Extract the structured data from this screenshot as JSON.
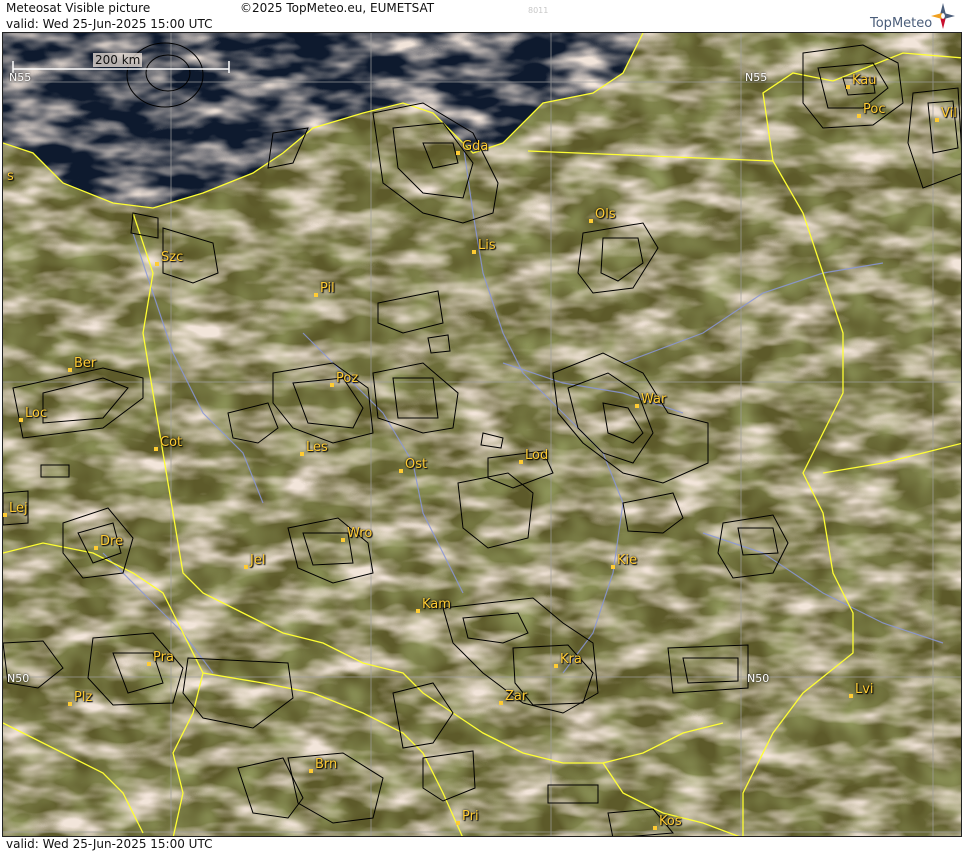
{
  "header": {
    "title": "Meteosat Visible picture",
    "valid": "valid:  Wed  25-Jun-2025  15:00 UTC",
    "copyright": "©2025 TopMeteo.eu, EUMETSAT",
    "code": "8011",
    "logo_text": "TopMeteo"
  },
  "footer": {
    "valid": "valid:  Wed  25-Jun-2025  15:00 UTC"
  },
  "scale_bar": {
    "label": "200 km"
  },
  "latitude_labels": [
    {
      "id": "n55-left",
      "text": "N55"
    },
    {
      "id": "n55-right",
      "text": "N55"
    },
    {
      "id": "n50-left",
      "text": "N50"
    },
    {
      "id": "n50-right",
      "text": "N50"
    }
  ],
  "cities": [
    {
      "id": "gda",
      "name": "Gda"
    },
    {
      "id": "kau",
      "name": "Kau"
    },
    {
      "id": "poc",
      "name": "Poc"
    },
    {
      "id": "vil",
      "name": "Vil"
    },
    {
      "id": "ols",
      "name": "Ols"
    },
    {
      "id": "lis",
      "name": "Lis"
    },
    {
      "id": "szc",
      "name": "Szc"
    },
    {
      "id": "pil",
      "name": "Pil"
    },
    {
      "id": "ber",
      "name": "Ber"
    },
    {
      "id": "poz",
      "name": "Poz"
    },
    {
      "id": "loc",
      "name": "Loc"
    },
    {
      "id": "war",
      "name": "War"
    },
    {
      "id": "cot",
      "name": "Cot"
    },
    {
      "id": "les",
      "name": "Les"
    },
    {
      "id": "ost",
      "name": "Ost"
    },
    {
      "id": "lod",
      "name": "Lod"
    },
    {
      "id": "lej",
      "name": "Lej"
    },
    {
      "id": "wro",
      "name": "Wro"
    },
    {
      "id": "dre",
      "name": "Dre"
    },
    {
      "id": "jel",
      "name": "Jel"
    },
    {
      "id": "kie",
      "name": "Kie"
    },
    {
      "id": "kam",
      "name": "Kam"
    },
    {
      "id": "pra",
      "name": "Pra"
    },
    {
      "id": "kra",
      "name": "Kra"
    },
    {
      "id": "lvi",
      "name": "Lvi"
    },
    {
      "id": "plz",
      "name": "Plz"
    },
    {
      "id": "zar",
      "name": "Zar"
    },
    {
      "id": "brn",
      "name": "Brn"
    },
    {
      "id": "pri",
      "name": "Pri"
    },
    {
      "id": "kos",
      "name": "Kos"
    },
    {
      "id": "s",
      "name": "s"
    }
  ],
  "colors": {
    "land": "#5d5a2a",
    "cloud": "#e2c6b2",
    "sea": "#0e1a2e",
    "border": "#ffff33",
    "river": "#8a96d8",
    "grid": "#9e9e9e",
    "city_label": "#ffcc33",
    "storm_outline": "#000000"
  }
}
